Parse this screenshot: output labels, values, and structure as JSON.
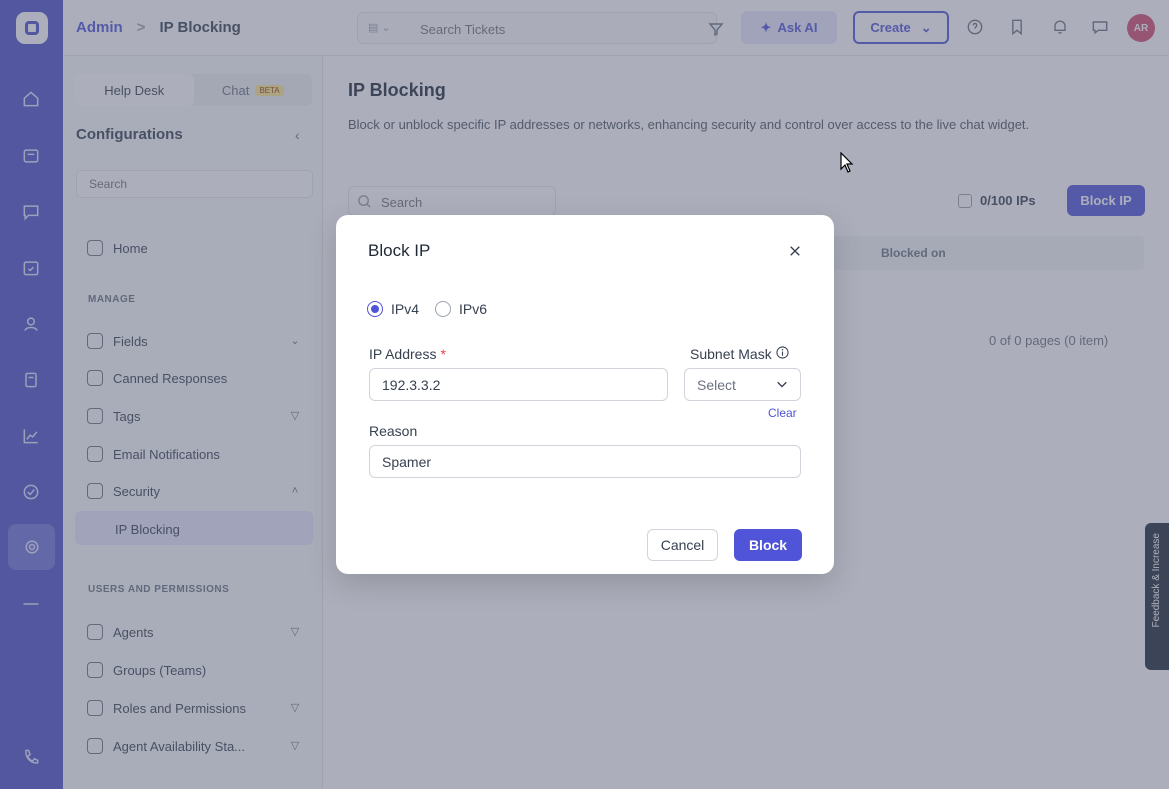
{
  "app": {
    "accent_color": "#4f54d8",
    "rail_color": "#4a4fc9"
  },
  "topbar": {
    "breadcrumb": {
      "root": "Admin",
      "separator": ">",
      "current": "IP Blocking"
    },
    "search_placeholder": "Search Tickets",
    "ask_ai_label": "Ask AI",
    "create_label": "Create",
    "avatar_initials": "AR"
  },
  "config_panel": {
    "tabs": [
      {
        "label": "Help Desk"
      },
      {
        "label": "Chat",
        "badge": "BETA"
      }
    ],
    "title": "Configurations",
    "search_placeholder": "Search",
    "home_label": "Home",
    "manage_section": "MANAGE",
    "manage_items": [
      {
        "label": "Fields"
      },
      {
        "label": "Canned Responses"
      },
      {
        "label": "Tags"
      },
      {
        "label": "Email Notifications"
      },
      {
        "label": "Security"
      },
      {
        "label": "IP Blocking"
      }
    ],
    "users_section": "USERS AND PERMISSIONS",
    "users_items": [
      {
        "label": "Agents"
      },
      {
        "label": "Groups (Teams)"
      },
      {
        "label": "Roles and Permissions"
      },
      {
        "label": "Agent Availability Sta..."
      }
    ]
  },
  "main": {
    "title": "IP Blocking",
    "description": "Block or unblock specific IP addresses or networks, enhancing security and control over access to the live chat widget.",
    "search_placeholder": "Search",
    "ip_count": "0/100 IPs",
    "block_ip_button": "Block IP",
    "table_column": "Blocked on",
    "pagination": "0 of 0 pages (0 item)",
    "feedback_tab": "Feedback & Increase"
  },
  "modal": {
    "title": "Block IP",
    "ip_versions": [
      {
        "label": "IPv4",
        "checked": true
      },
      {
        "label": "IPv6",
        "checked": false
      }
    ],
    "ip_address": {
      "label": "IP Address",
      "required_mark": "*",
      "value": "192.3.3.2"
    },
    "subnet_mask": {
      "label": "Subnet Mask",
      "placeholder": "Select",
      "clear_label": "Clear"
    },
    "reason": {
      "label": "Reason",
      "value": "Spamer"
    },
    "cancel_label": "Cancel",
    "submit_label": "Block"
  }
}
